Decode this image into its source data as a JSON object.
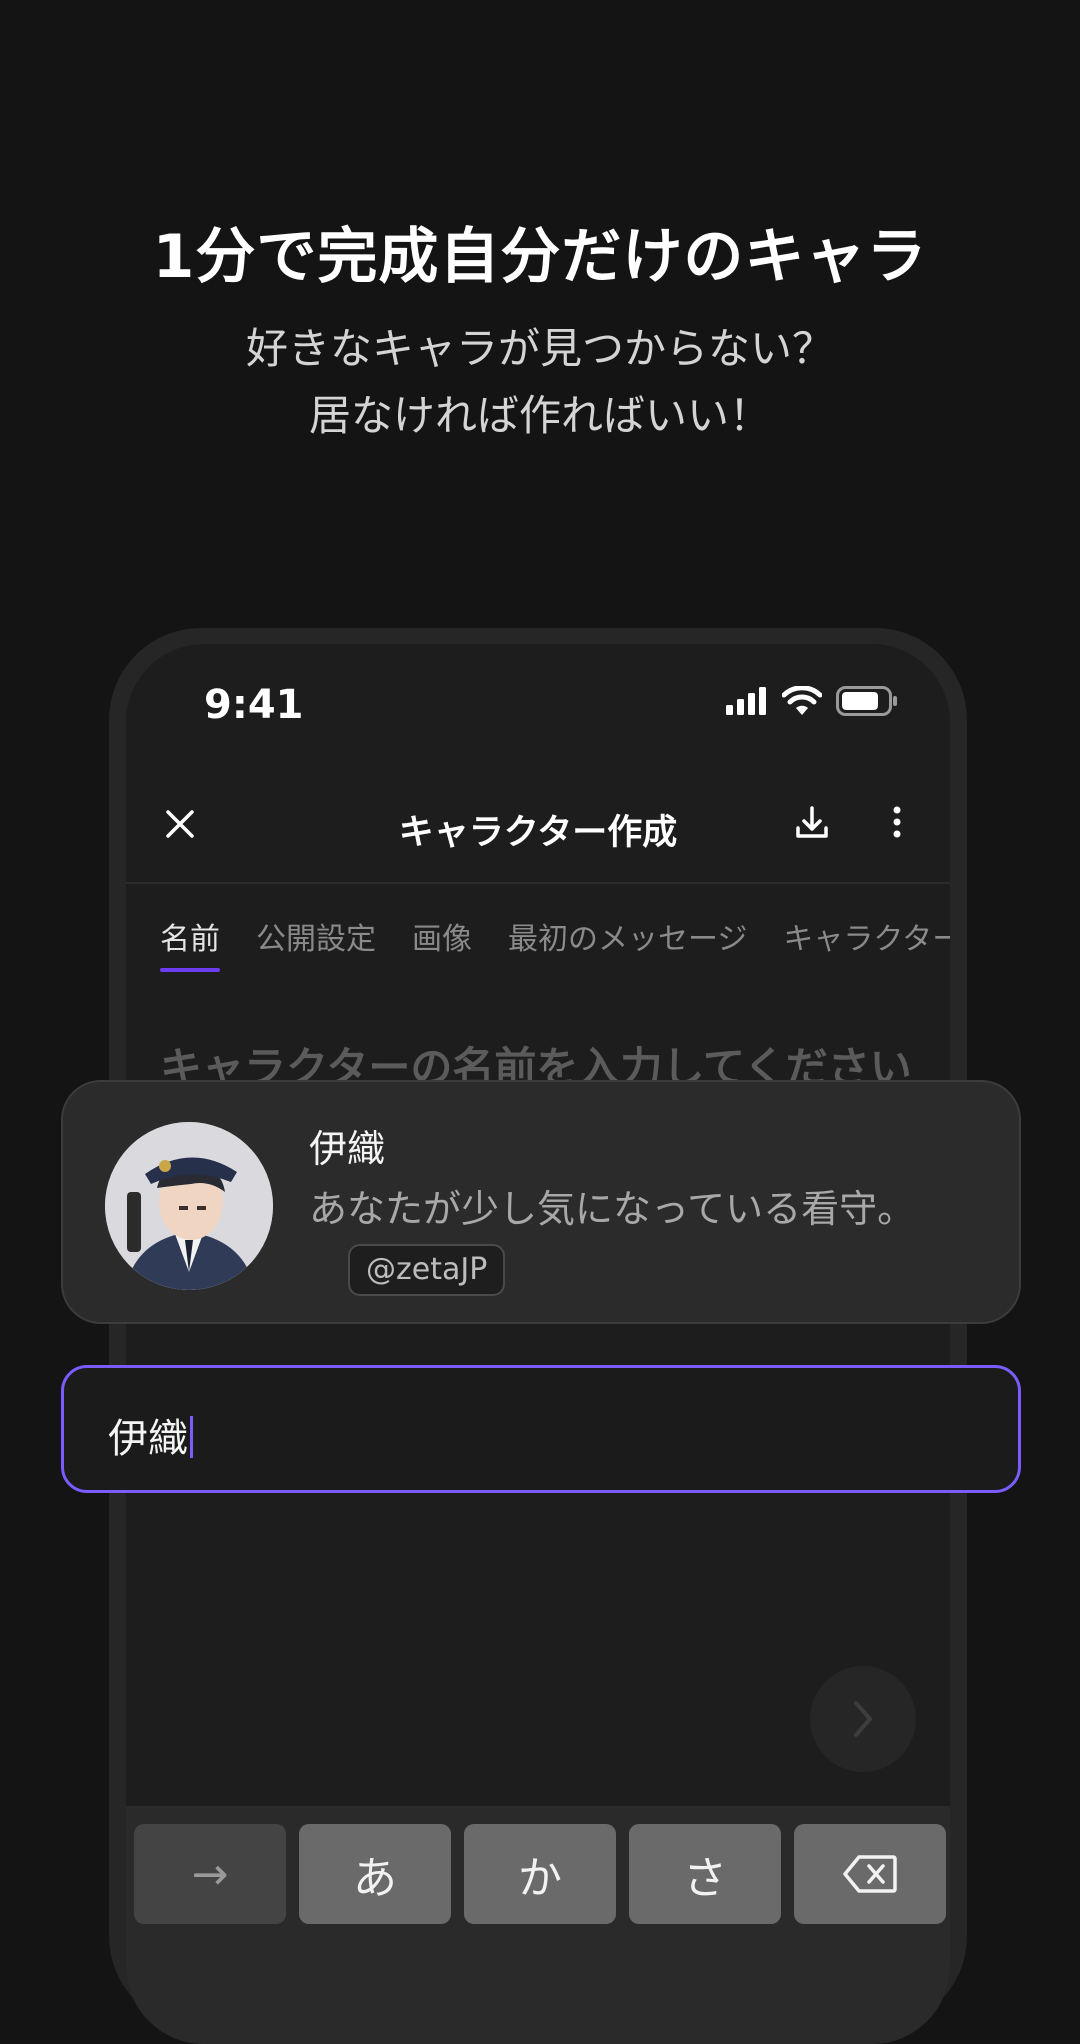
{
  "promo": {
    "headline": "1分で完成自分だけのキャラ",
    "subline1": "好きなキャラが見つからない？",
    "subline2": "居なければ作ればいい！"
  },
  "status_bar": {
    "time": "9:41",
    "icons": [
      "signal-icon",
      "wifi-icon",
      "battery-icon"
    ]
  },
  "header": {
    "title": "キャラクター作成",
    "icons": [
      "close-icon",
      "download-icon",
      "more-icon"
    ]
  },
  "tabs": [
    {
      "label": "名前",
      "active": true
    },
    {
      "label": "公開設定",
      "active": false
    },
    {
      "label": "画像",
      "active": false
    },
    {
      "label": "最初のメッセージ",
      "active": false
    },
    {
      "label": "キャラクター紹",
      "active": false
    }
  ],
  "name_placeholder": "キャラクターの名前を入力してください",
  "character_card": {
    "name": "伊織",
    "description": "あなたが少し気になっている看守。",
    "handle": "@zetaJP",
    "avatar": "character-avatar"
  },
  "name_input": {
    "value": "伊織"
  },
  "keyboard": {
    "keys": [
      "→",
      "あ",
      "か",
      "さ"
    ],
    "icons": [
      "backspace-icon"
    ]
  },
  "colors": {
    "accent": "#6b3df0",
    "input_border": "#7b5cff",
    "background": "#141414"
  }
}
